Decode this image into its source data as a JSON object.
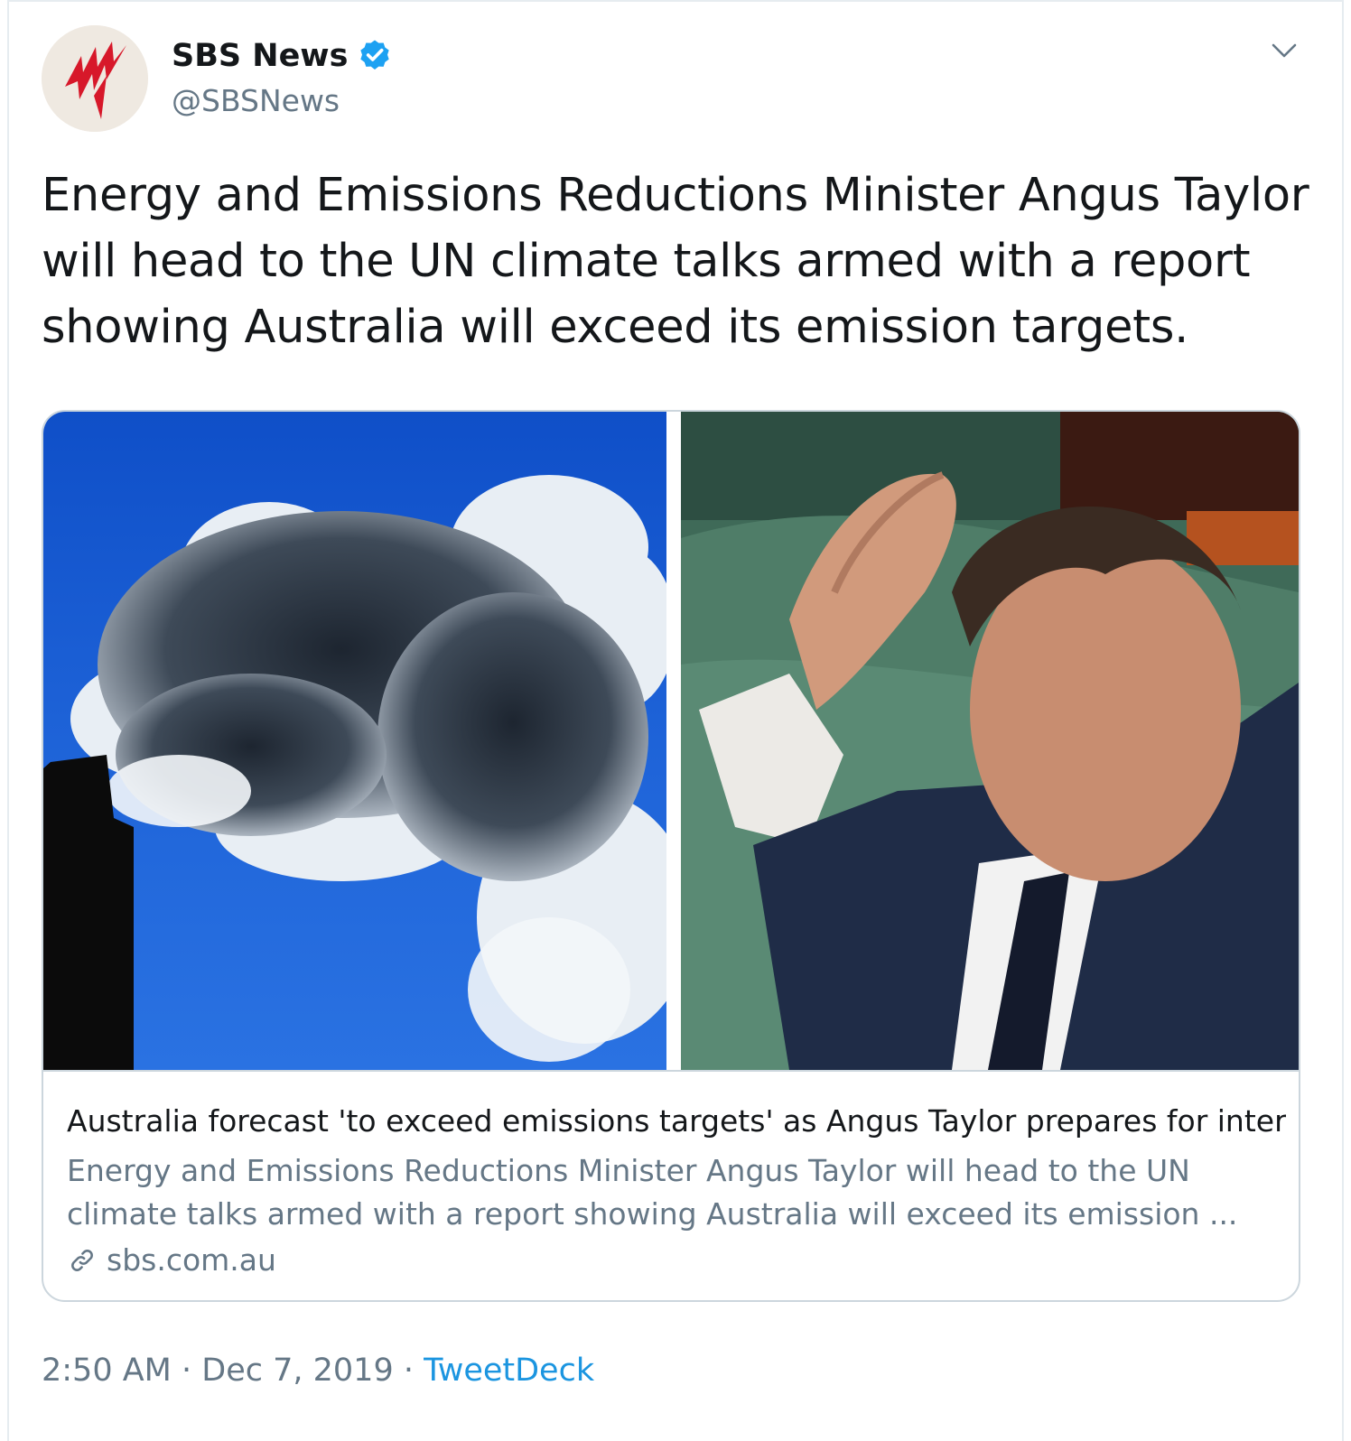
{
  "tweet": {
    "author": {
      "display_name": "SBS News",
      "handle": "@SBSNews",
      "verified": true,
      "avatar_icon": "sbs-logo-icon"
    },
    "text": "Energy and Emissions Reductions Minister Angus Taylor will head to the UN climate talks armed with a report showing Australia will exceed its emission targets.",
    "card": {
      "images": [
        {
          "icon": "smokestack-photo"
        },
        {
          "icon": "minister-photo"
        }
      ],
      "title": "Australia forecast 'to exceed emissions targets' as Angus Taylor prepares for inter...",
      "description": "Energy and Emissions Reductions Minister Angus Taylor will head to the UN climate talks armed with a report showing Australia will exceed its emission ...",
      "domain": "sbs.com.au"
    },
    "meta": {
      "time": "2:50 AM",
      "separator": " · ",
      "date": "Dec 7, 2019",
      "app": "TweetDeck"
    }
  },
  "colors": {
    "primary_text": "#14171a",
    "secondary_text": "#657786",
    "link_blue": "#1b95e0",
    "verified_blue": "#1da1f2",
    "border": "#ccd6dd",
    "sbs_red": "#d7182a"
  }
}
